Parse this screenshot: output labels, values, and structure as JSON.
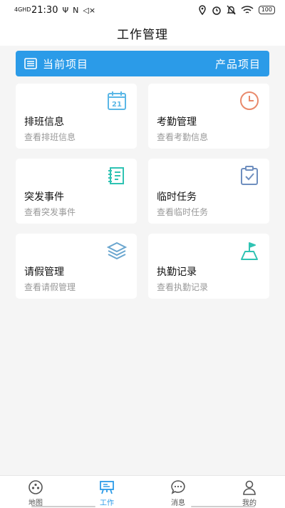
{
  "status_bar": {
    "network": "4GHD",
    "time": "21:30",
    "usb": "Ψ",
    "nfc": "N",
    "mute": "◁×",
    "battery": "100"
  },
  "header": {
    "title": "工作管理"
  },
  "project_bar": {
    "label": "当前项目",
    "value": "产品项目"
  },
  "cards": [
    {
      "title": "排班信息",
      "subtitle": "查看排班信息",
      "icon": "calendar-icon"
    },
    {
      "title": "考勤管理",
      "subtitle": "查看考勤信息",
      "icon": "clock-icon"
    },
    {
      "title": "突发事件",
      "subtitle": "查看突发事件",
      "icon": "notebook-icon"
    },
    {
      "title": "临时任务",
      "subtitle": "查看临时任务",
      "icon": "clipboard-check-icon"
    },
    {
      "title": "请假管理",
      "subtitle": "查看请假管理",
      "icon": "layers-icon"
    },
    {
      "title": "执勤记录",
      "subtitle": "查看执勤记录",
      "icon": "flag-icon"
    }
  ],
  "calendar_day": "21",
  "bottom_nav": [
    {
      "label": "地图",
      "icon": "map-icon"
    },
    {
      "label": "工作",
      "icon": "work-board-icon",
      "active": true
    },
    {
      "label": "消息",
      "icon": "message-icon"
    },
    {
      "label": "我的",
      "icon": "user-icon"
    }
  ],
  "colors": {
    "primary": "#2b9be8",
    "teal": "#2fc3b3",
    "orange": "#e9896b",
    "slate": "#6f8fbf"
  }
}
